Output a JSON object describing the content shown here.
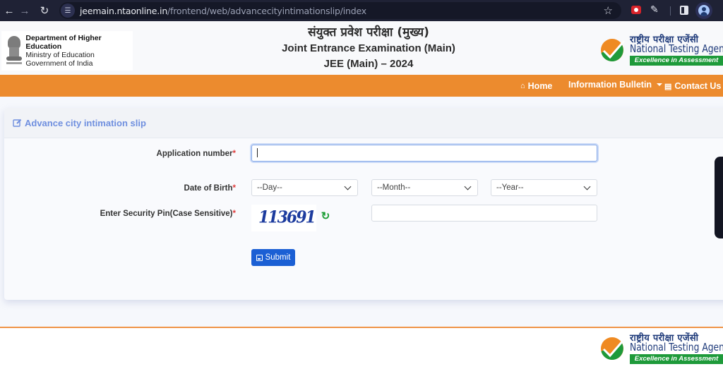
{
  "browser": {
    "url_host": "jeemain.ntaonline.in",
    "url_path": "/frontend/web/advancecityintimationslip/index",
    "icons": [
      "back-arrow-icon",
      "forward-arrow-icon",
      "reload-icon",
      "site-info-icon",
      "bookmark-star-icon",
      "extension-icon",
      "puzzle-extensions-icon",
      "side-panel-icon",
      "profile-avatar-icon"
    ]
  },
  "header": {
    "dept_line1": "Department of Higher Education",
    "dept_line2": "Ministry of Education",
    "dept_line3": "Government of India",
    "title_hindi": "संयुक्त प्रवेश परीक्षा (मुख्य)",
    "title_en": "Joint Entrance Examination (Main)",
    "title_year": "JEE (Main) – 2024",
    "nta_hindi": "राष्ट्रीय परीक्षा एजेंसी",
    "nta_name": "National Testing Agency",
    "nta_tagline": "Excellence in Assessment"
  },
  "nav": {
    "home": "Home",
    "info_bulletin": "Information Bulletin",
    "contact": "Contact Us"
  },
  "form": {
    "title": "Advance city intimation slip",
    "app_number_label": "Application number",
    "app_number_value": "",
    "dob_label": "Date of Birth",
    "day_selected": "--Day--",
    "month_selected": "--Month--",
    "year_selected": "--Year--",
    "pin_label": "Enter Security Pin(Case Sensitive)",
    "captcha_text": "113691",
    "pin_value": "",
    "required_mark": "*",
    "submit_label": "Submit"
  },
  "footer": {
    "nta_hindi": "राष्ट्रीय परीक्षा एजेंसी",
    "nta_name": "National Testing Agency",
    "nta_tagline": "Excellence in Assessment"
  },
  "colors": {
    "nav_orange": "#ec8b2e",
    "title_blue": "#6f8fdf",
    "submit_blue": "#1b5fd4",
    "required_red": "#e03a3a",
    "nta_green": "#1e9a3a"
  }
}
